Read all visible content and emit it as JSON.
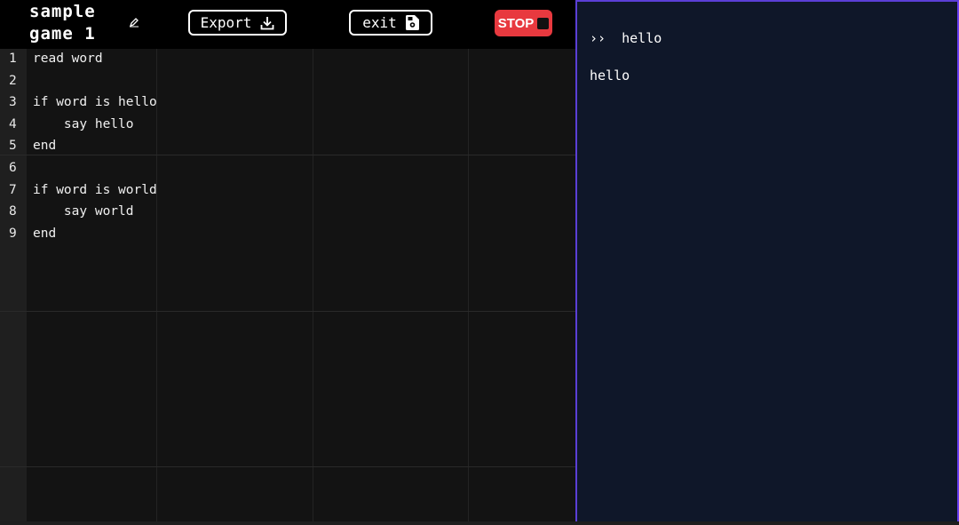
{
  "header": {
    "title_line1": "sample",
    "title_line2": "game 1",
    "export_label": "Export",
    "exit_label": "exit",
    "stop_label": "STOP"
  },
  "editor": {
    "lines": [
      {
        "num": "1",
        "text": "read word"
      },
      {
        "num": "2",
        "text": ""
      },
      {
        "num": "3",
        "text": "if word is hello"
      },
      {
        "num": "4",
        "text": "    say hello"
      },
      {
        "num": "5",
        "text": "end"
      },
      {
        "num": "6",
        "text": ""
      },
      {
        "num": "7",
        "text": "if word is world"
      },
      {
        "num": "8",
        "text": "    say world"
      },
      {
        "num": "9",
        "text": "end"
      }
    ]
  },
  "console": {
    "prompt_symbol": "››",
    "input": "hello",
    "output": "hello"
  },
  "colors": {
    "stop": "#e8393f",
    "console_bg": "#0f1729",
    "console_border": "#5b3fd6"
  }
}
